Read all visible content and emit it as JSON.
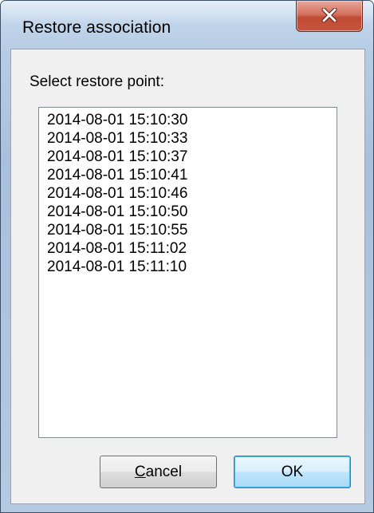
{
  "window": {
    "title": "Restore association",
    "close_icon": "close-x-icon"
  },
  "dialog": {
    "prompt": "Select restore point:",
    "restore_points": [
      "2014-08-01 15:10:30",
      "2014-08-01 15:10:33",
      "2014-08-01 15:10:37",
      "2014-08-01 15:10:41",
      "2014-08-01 15:10:46",
      "2014-08-01 15:10:50",
      "2014-08-01 15:10:55",
      "2014-08-01 15:11:02",
      "2014-08-01 15:11:10"
    ],
    "cancel_mnemonic": "C",
    "cancel_rest": "ancel",
    "ok_label": "OK"
  },
  "colors": {
    "frame": "#b7cde6",
    "close_button": "#c7563f",
    "ok_button_border": "#3c7fb1"
  }
}
